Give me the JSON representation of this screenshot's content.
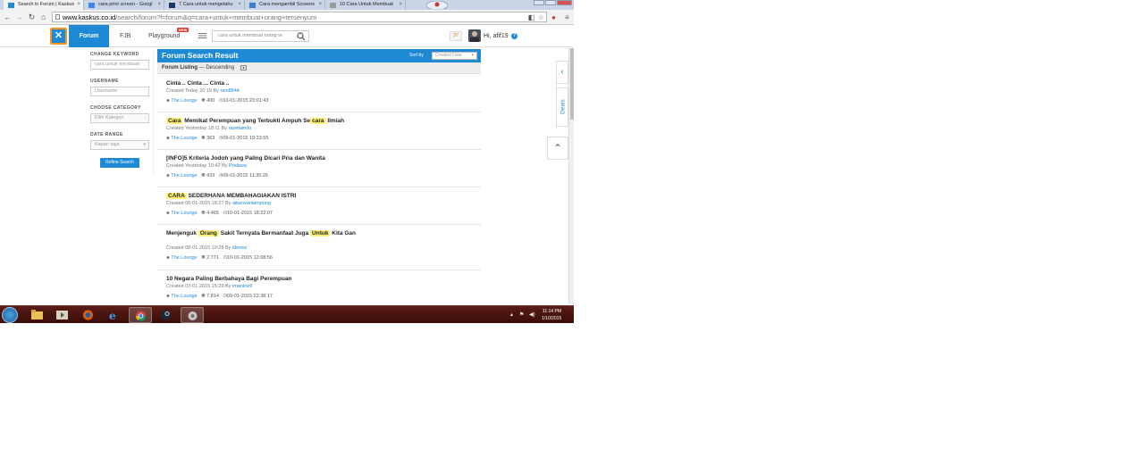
{
  "browser": {
    "tabs": [
      {
        "title": "Search in Forum | Kaskus",
        "active": true
      },
      {
        "title": "cara print screen - Googl"
      },
      {
        "title": "7 Cara untuk mengetahu"
      },
      {
        "title": "Cara mengambil Screens"
      },
      {
        "title": "10 Cara Untuk Membuat"
      }
    ],
    "url_host": "www.kaskus.co.id",
    "url_path": "/search/forum?f=forum&q=cara+untuk+membuat+orang+tersenyum"
  },
  "header": {
    "logo_glyph": "✕",
    "nav": {
      "forum": "Forum",
      "fjb": "FJB",
      "playground": "Playground",
      "new_badge": "NEW"
    },
    "search_value": "cara untuk membuat orang te",
    "notif_count": "37",
    "greeting": "Hi, afif19"
  },
  "sidebar": {
    "change_keyword_label": "CHANGE KEYWORD",
    "keyword_value": "cara untuk membuat",
    "username_label": "USERNAME",
    "username_placeholder": "Username",
    "category_label": "CHOOSE CATEGORY",
    "category_value": "Pilih Kategori",
    "date_range_label": "DATE RANGE",
    "date_range_value": "Kapan saja",
    "refine_button": "Refine Search"
  },
  "results": {
    "title": "Forum Search Result",
    "sort_label": "Sort by",
    "sort_value": "Created Date",
    "listing_label": "Forum Listing",
    "listing_order": "— Descending",
    "items": [
      {
        "title_parts": [
          {
            "t": "Cinta .. Cinta ... Cinta .."
          }
        ],
        "created": "Created Today 20:19 By",
        "author": "rain8844",
        "category": "The Lounge",
        "views": "400",
        "last": "10-01-2015 23:01:43"
      },
      {
        "title_parts": [
          {
            "t": "Cara",
            "hl": true
          },
          {
            "t": " Memikat Perempuan yang Terbukti Ampuh Se"
          },
          {
            "t": "cara",
            "hl": true
          },
          {
            "t": " Ilmiah"
          }
        ],
        "created": "Created Yesterday 18:11 By",
        "author": "razetaindo",
        "category": "The Lounge",
        "views": "363",
        "last": "09-01-2015 19:33:55"
      },
      {
        "title_parts": [
          {
            "t": "[INFO]5 Kriteria Jodoh yang Paling Dicari Pria dan Wanita"
          }
        ],
        "created": "Created Yesterday 10:42 By",
        "author": "Pridawa",
        "category": "The Lounge",
        "views": "433",
        "last": "09-01-2015 11:35:26"
      },
      {
        "title_parts": [
          {
            "t": "CARA",
            "hl": true
          },
          {
            "t": " SEDERHANA MEMBAHAGIAKAN ISTRI"
          }
        ],
        "created": "Created 08-01-2015 18:27 By",
        "author": "aikenvanlampung",
        "category": "The Lounge",
        "views": "4,465",
        "last": "10-01-2015 18:22:07"
      },
      {
        "title_parts": [
          {
            "t": "Menjenguk "
          },
          {
            "t": "Orang",
            "hl": true
          },
          {
            "t": " Sakit Ternyata Bermanfaat Juga "
          },
          {
            "t": "Untuk",
            "hl": true
          },
          {
            "t": " Kita Gan"
          }
        ],
        "created": "Created 08-01-2015 10:28 By",
        "author": "idenez",
        "category": "The Lounge",
        "views": "2,771",
        "last": "10-01-2015 12:08:56"
      },
      {
        "title_parts": [
          {
            "t": "10 Negara Paling Berbahaya Bagi Perempuan"
          }
        ],
        "created": "Created 07-01-2015 15:29 By",
        "author": "imanine9",
        "category": "The Lounge",
        "views": "7,814",
        "last": "09-01-2015 22:38:17"
      }
    ]
  },
  "side": {
    "deals": "Deals"
  },
  "taskbar": {
    "time": "11:14 PM",
    "date": "1/10/2015"
  },
  "colors": {
    "accent": "#1e8ad6",
    "highlight": "#fff176",
    "taskbar": "#4a1510"
  }
}
